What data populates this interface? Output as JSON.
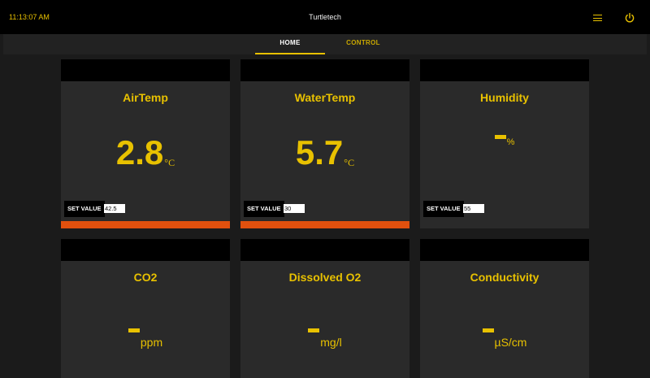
{
  "header": {
    "time": "11:13:07 AM",
    "title": "Turtletech"
  },
  "tabs": [
    {
      "label": "HOME",
      "active": true
    },
    {
      "label": "CONTROL",
      "active": false
    }
  ],
  "cards": [
    {
      "title": "AirTemp",
      "value": "2.8",
      "unit": "°C",
      "set_label": "SET VALUE",
      "set_value": "42.5"
    },
    {
      "title": "WaterTemp",
      "value": "5.7",
      "unit": "°C",
      "set_label": "SET VALUE",
      "set_value": "30"
    },
    {
      "title": "Humidity",
      "value": "",
      "unit": "%",
      "set_label": "SET VALUE",
      "set_value": "55"
    },
    {
      "title": "CO2",
      "value": "",
      "unit": "ppm"
    },
    {
      "title": "Dissolved O2",
      "value": "",
      "unit": "mg/l"
    },
    {
      "title": "Conductivity",
      "value": "",
      "unit": "µS/cm"
    }
  ],
  "colors": {
    "accent": "#e8c100",
    "alert_bar": "#e0500e",
    "background": "#1b1b1b",
    "card": "#2a2a2a"
  },
  "icons": {
    "menu": "hamburger-menu-icon",
    "power": "power-icon"
  }
}
